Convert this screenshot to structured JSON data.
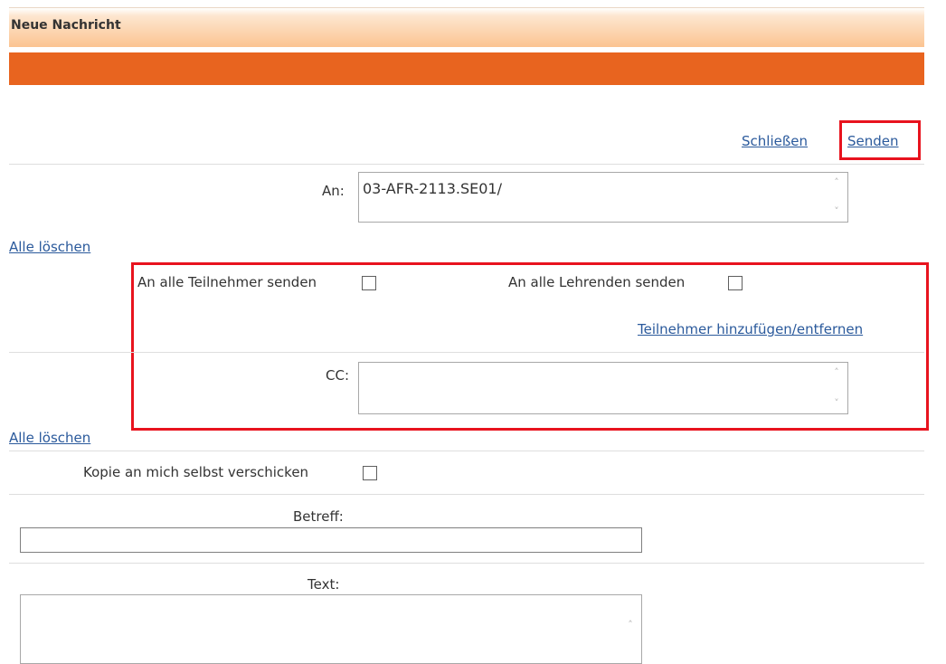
{
  "header": {
    "title": "Neue Nachricht"
  },
  "toolbar": {
    "close_label": "Schließen",
    "send_label": "Senden"
  },
  "recipients": {
    "to_label": "An:",
    "to_value": "03-AFR-2113.SE01/",
    "clear_all_label": "Alle löschen",
    "all_participants_label": "An alle Teilnehmer senden",
    "all_teachers_label": "An alle Lehrenden senden",
    "add_remove_participants_label": "Teilnehmer hinzufügen/entfernen",
    "cc_label": "CC:",
    "cc_value": "",
    "cc_clear_all_label": "Alle löschen",
    "copy_to_self_label": "Kopie an mich selbst verschicken"
  },
  "message": {
    "subject_label": "Betreff:",
    "subject_value": "",
    "text_label": "Text:",
    "text_value": ""
  },
  "colors": {
    "accent_orange": "#e8641f",
    "link_blue": "#2b5a9c",
    "highlight_red": "#e8131e"
  },
  "icons": {
    "scroll_up": "chevron-up-icon",
    "scroll_down": "chevron-down-icon"
  }
}
